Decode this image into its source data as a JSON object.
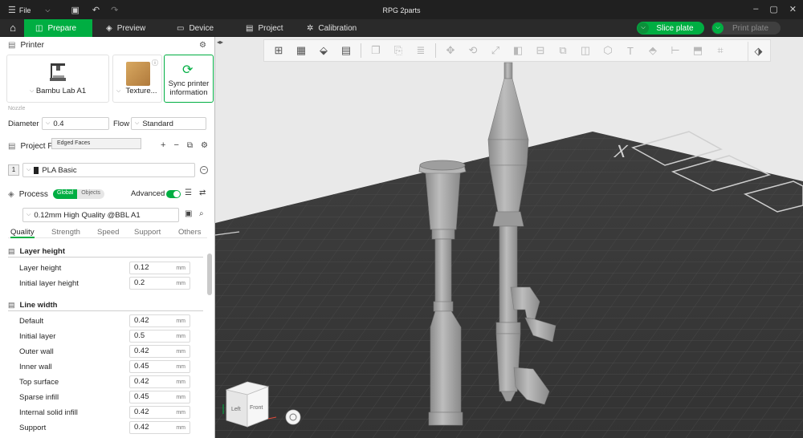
{
  "window": {
    "title": "RPG 2parts",
    "file_menu": "File"
  },
  "tabs": [
    {
      "label": "Prepare",
      "active": true
    },
    {
      "label": "Preview"
    },
    {
      "label": "Device"
    },
    {
      "label": "Project"
    },
    {
      "label": "Calibration"
    }
  ],
  "actions": {
    "slice": "Slice plate",
    "print": "Print plate"
  },
  "printer": {
    "section_title": "Printer",
    "printer_name": "Bambu Lab A1",
    "plate_name": "Texture...",
    "sync_label": "Sync printer information",
    "nozzle_label": "Nozzle",
    "diameter_label": "Diameter",
    "diameter_value": "0.4",
    "flow_label": "Flow",
    "flow_value": "Standard"
  },
  "filament": {
    "section_title": "Project Filament",
    "tooltip": "Edged Faces",
    "slot_number": "1",
    "material": "PLA Basic"
  },
  "process": {
    "section_title": "Process",
    "global_label": "Global",
    "objects_label": "Objects",
    "advanced_label": "Advanced",
    "preset": "0.12mm High Quality @BBL A1",
    "subtabs": [
      "Quality",
      "Strength",
      "Speed",
      "Support",
      "Others"
    ],
    "groups": [
      {
        "title": "Layer height",
        "params": [
          {
            "label": "Layer height",
            "value": "0.12",
            "unit": "mm"
          },
          {
            "label": "Initial layer height",
            "value": "0.2",
            "unit": "mm"
          }
        ]
      },
      {
        "title": "Line width",
        "params": [
          {
            "label": "Default",
            "value": "0.42",
            "unit": "mm"
          },
          {
            "label": "Initial layer",
            "value": "0.5",
            "unit": "mm"
          },
          {
            "label": "Outer wall",
            "value": "0.42",
            "unit": "mm"
          },
          {
            "label": "Inner wall",
            "value": "0.45",
            "unit": "mm"
          },
          {
            "label": "Top surface",
            "value": "0.42",
            "unit": "mm"
          },
          {
            "label": "Sparse infill",
            "value": "0.45",
            "unit": "mm"
          },
          {
            "label": "Internal solid infill",
            "value": "0.42",
            "unit": "mm"
          },
          {
            "label": "Support",
            "value": "0.42",
            "unit": "mm"
          }
        ]
      }
    ]
  },
  "viewcube": {
    "left": "Left",
    "front": "Front"
  },
  "colors": {
    "accent": "#00ae42",
    "titlebar": "#202020",
    "bed": "#3a3a3a",
    "model": "#a8a8a8"
  }
}
